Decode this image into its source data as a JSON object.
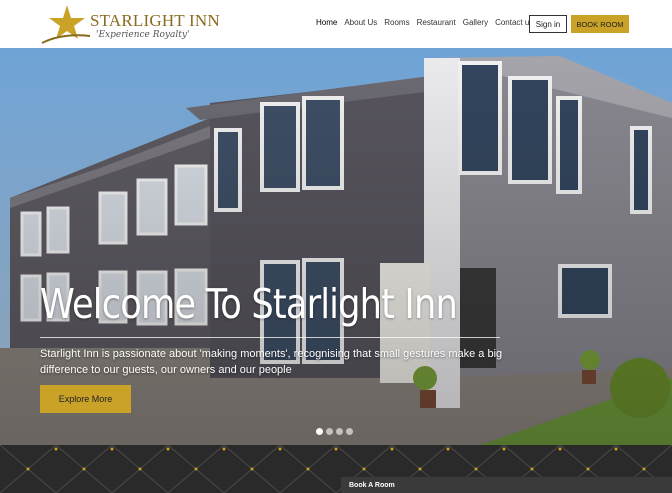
{
  "brand": {
    "name": "STARLIGHT INN",
    "tagline": "'Experience Royalty'",
    "color": "#c9a227"
  },
  "nav": {
    "items": [
      {
        "label": "Home",
        "active": true
      },
      {
        "label": "About Us"
      },
      {
        "label": "Rooms"
      },
      {
        "label": "Restaurant"
      },
      {
        "label": "Gallery"
      },
      {
        "label": "Contact us"
      }
    ],
    "signin_label": "Sign in",
    "book_label": "BOOK ROOM"
  },
  "hero": {
    "title": "Welcome To Starlight Inn",
    "subtitle": "Starlight Inn is passionate about 'making moments', recognising that small gestures make a big difference to our guests, our owners and our people",
    "cta_label": "Explore More",
    "slides_count": 4,
    "active_slide": 1
  },
  "booking_bar": {
    "label": "Book A Room"
  }
}
